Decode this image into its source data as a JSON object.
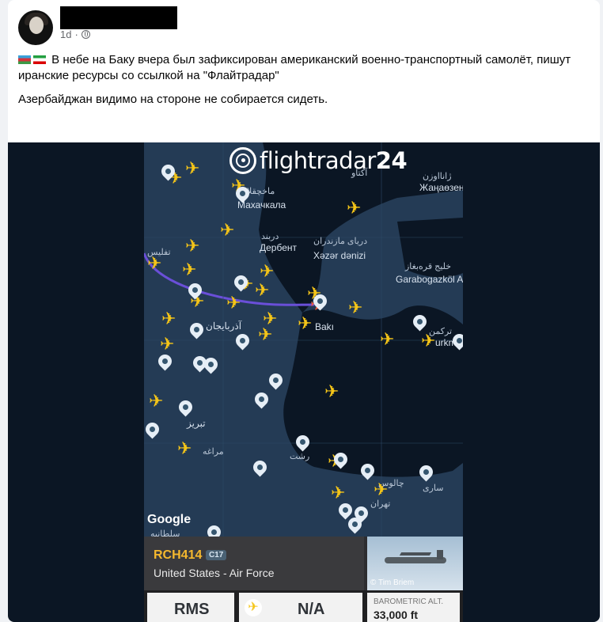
{
  "post": {
    "timestamp": "1d",
    "separator": "·",
    "text_line1": "В небе на Баку вчера был зафиксирован американский военно-транспортный самолёт, пишут иранские ресурсы со ссылкой на \"Флайтрадар\"",
    "text_line2": "Азербайджан видимо на стороне не собирается сидеть."
  },
  "map": {
    "brand_name": "flightradar",
    "brand_number": "24",
    "labels": {
      "makhachkala_fa": "ماخچقلا",
      "makhachkala": "Махачкала",
      "derbent_fa": "دربند",
      "derbent": "Дербент",
      "caspian_fa": "دریای مازندران",
      "caspian_az": "Xəzər dənizi",
      "karabogaz_fa": "خلیج قره‌بغاز",
      "karabogaz": "Garabogazköl A",
      "zhanaozen_fa": "ژانااوزن",
      "zhanaozen": "Жаңаөзен",
      "tbilisi_fa": "تفلیس",
      "baku": "Bakı",
      "azerbaijan_fa": "آذربایجان",
      "turkmen_fa": "ترکمن",
      "turkmen": "urkme",
      "tabriz_fa": "تبریز",
      "maragheh_fa": "مراغه",
      "rasht_fa": "رشت",
      "chalus_fa": "چالوس",
      "sari_fa": "ساری",
      "tehran_fa": "تهران",
      "soltanieh_fa": "سلطانیه",
      "aktau_fa": "آکتاو",
      "google": "Google"
    }
  },
  "flight": {
    "callsign": "RCH414",
    "aircraft": "C17",
    "operator": "United States - Air Force",
    "photo_credit": "© Tim Briem",
    "origin": "RMS",
    "destination": "N/A",
    "alt_label": "BAROMETRIC ALT.",
    "alt_value": "33,000 ft"
  },
  "colors": {
    "accent_callsign": "#f5b82e",
    "plane": "#f5c518",
    "selected_plane": "#ff5a36",
    "route": "#6a4fd8",
    "sea": "#0b1624",
    "land": "#243b55"
  },
  "icons": [
    "globe-icon",
    "flightradar-logo-icon",
    "plane-icon",
    "map-pin-icon",
    "flag-az-icon",
    "flag-ir-icon"
  ]
}
